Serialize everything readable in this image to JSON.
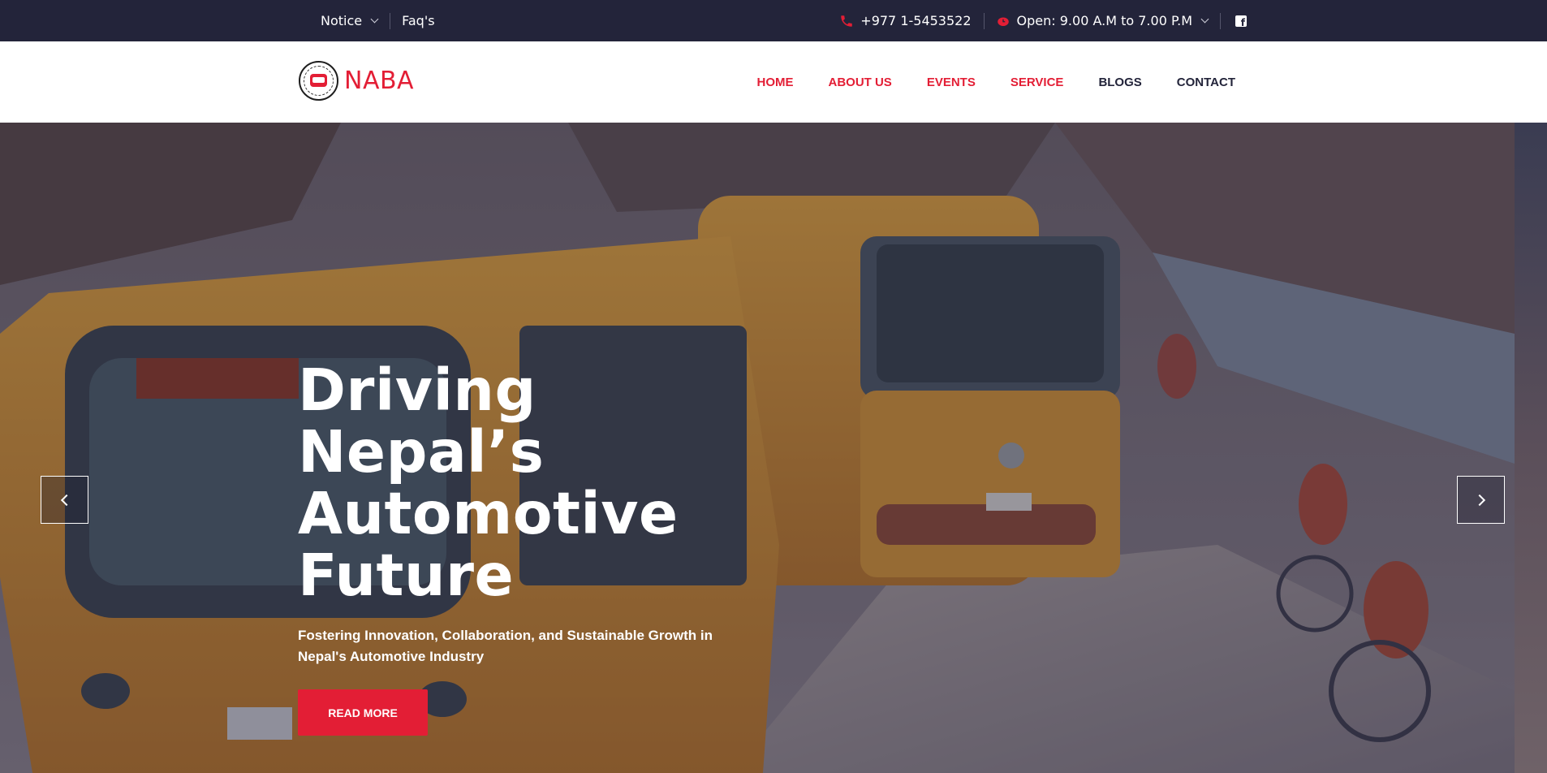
{
  "topbar": {
    "notice_label": "Notice",
    "faq_label": "Faq's",
    "phone": "+977 1-5453522",
    "hours": "Open: 9.00 A.M to 7.00 P.M"
  },
  "brand": {
    "name": "NABA"
  },
  "nav": {
    "items": [
      {
        "label": "HOME"
      },
      {
        "label": "ABOUT US"
      },
      {
        "label": "EVENTS"
      },
      {
        "label": "SERVICE"
      },
      {
        "label": "BLOGS"
      },
      {
        "label": "CONTACT"
      }
    ]
  },
  "hero": {
    "title_line1": "Driving Nepal’s",
    "title_line2": "Automotive",
    "title_line3": "Future",
    "subtitle": "Fostering Innovation, Collaboration, and Sustainable Growth in Nepal's Automotive Industry",
    "button_label": "READ MORE"
  },
  "icons": {
    "phone": "phone-icon",
    "clock": "clock-icon",
    "facebook": "facebook-icon",
    "prev": "chevron-left-icon",
    "next": "chevron-right-icon"
  },
  "colors": {
    "accent": "#e31e35",
    "topbar_bg": "#23243a",
    "nav_dark": "#23243a",
    "header_bg": "#ffffff"
  }
}
